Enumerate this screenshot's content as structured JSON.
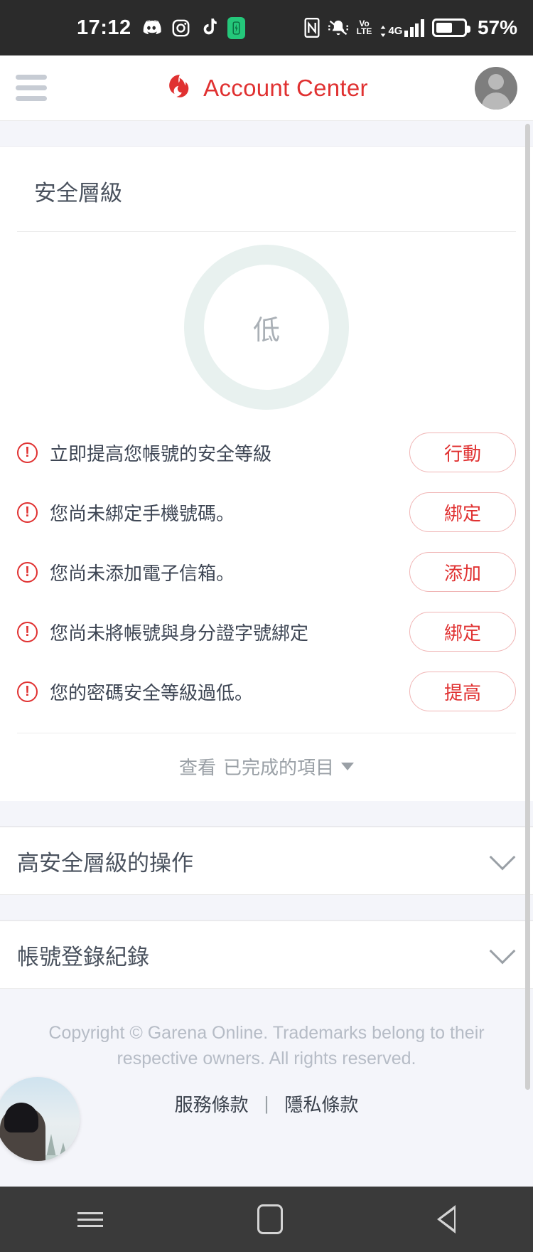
{
  "status_bar": {
    "time": "17:12",
    "battery_percent": "57%",
    "left_icons": [
      "discord-icon",
      "instagram-icon",
      "tiktok-icon",
      "battery-saver-icon"
    ],
    "right_icons": [
      "nfc-icon",
      "ringer-muted-icon",
      "volte-icon",
      "network-4g-plus-icon",
      "battery-icon"
    ],
    "volte_label_top": "Vo",
    "volte_label_bottom": "LTE",
    "network_label": "4G",
    "colors": {
      "bar_background": "#2b2b2b",
      "battery_saver": "#24c77a"
    }
  },
  "header": {
    "title": "Account Center",
    "menu_icon": "hamburger-menu-icon",
    "logo_icon": "garena-logo-icon",
    "avatar_icon": "user-avatar-icon",
    "brand_color": "#e03131"
  },
  "security_card": {
    "title": "安全層級",
    "gauge": {
      "level_label": "低",
      "ring_color": "#e8f1ef"
    },
    "items": [
      {
        "text": "立即提高您帳號的安全等級",
        "action_label": "行動",
        "icon": "warning-circle-icon"
      },
      {
        "text": "您尚未綁定手機號碼。",
        "action_label": "綁定",
        "icon": "warning-circle-icon"
      },
      {
        "text": "您尚未添加電子信箱。",
        "action_label": "添加",
        "icon": "warning-circle-icon"
      },
      {
        "text": "您尚未將帳號與身分證字號綁定",
        "action_label": "綁定",
        "icon": "warning-circle-icon"
      },
      {
        "text": "您的密碼安全等級過低。",
        "action_label": "提高",
        "icon": "warning-circle-icon"
      }
    ],
    "completed_toggle": {
      "prefix": "查看",
      "label": "已完成的項目",
      "icon": "chevron-down-icon"
    }
  },
  "sections": [
    {
      "title": "高安全層級的操作",
      "icon": "chevron-down-icon"
    },
    {
      "title": "帳號登錄紀錄",
      "icon": "chevron-down-icon"
    }
  ],
  "footer": {
    "copyright": "Copyright © Garena Online. Trademarks belong to their respective owners. All rights reserved.",
    "terms_label": "服務條款",
    "separator": "|",
    "privacy_label": "隱私條款",
    "floating_avatar_icon": "floating-profile-avatar"
  },
  "nav_bar": {
    "recents_icon": "recents-icon",
    "home_icon": "home-icon",
    "back_icon": "back-icon"
  }
}
